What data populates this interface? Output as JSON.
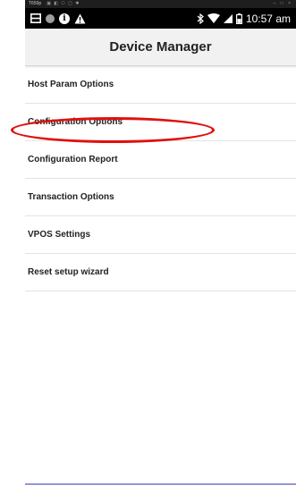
{
  "emulator": {
    "title": "T650p",
    "controls": "– □ ×"
  },
  "status_bar": {
    "time": "10:57 am",
    "icons": [
      "notification-window-icon",
      "circle-icon",
      "info-icon",
      "warning-icon",
      "bluetooth-icon",
      "wifi-icon",
      "signal-icon",
      "battery-icon"
    ]
  },
  "app_bar": {
    "title": "Device Manager"
  },
  "menu": {
    "items": [
      {
        "label": "Host Param Options"
      },
      {
        "label": "Configuration Options"
      },
      {
        "label": "Configuration Report"
      },
      {
        "label": "Transaction Options"
      },
      {
        "label": "VPOS Settings"
      },
      {
        "label": "Reset setup wizard"
      }
    ]
  },
  "colors": {
    "status_bar": "#000000",
    "app_bar": "#f1f1f1",
    "highlight": "#e01010",
    "bottom_line": "#3a3fbf"
  }
}
